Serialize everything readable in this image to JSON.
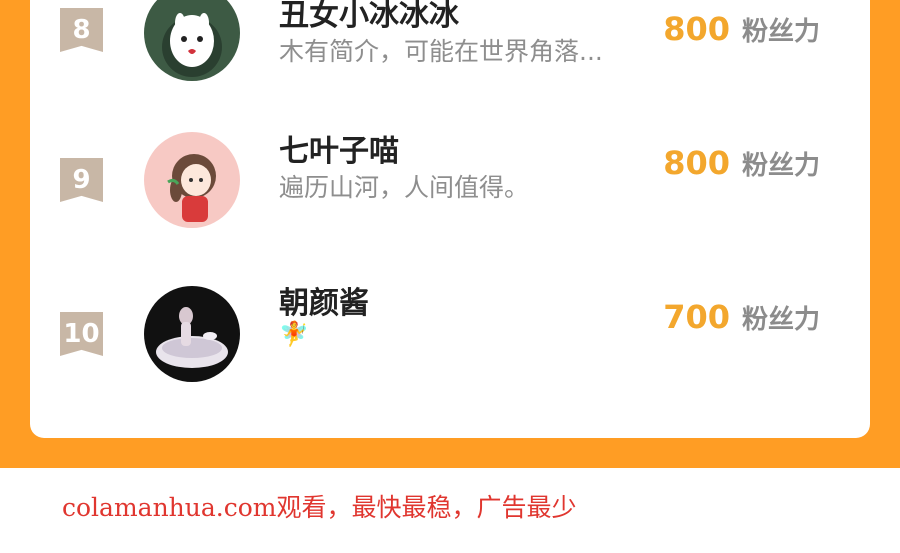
{
  "leaderboard": {
    "score_unit": "粉丝力",
    "items": [
      {
        "rank": "8",
        "name": "丑女小冰冰冰",
        "bio": "木有简介，可能在世界角落...",
        "score": "800",
        "avatar_icon": "white-cat-avatar"
      },
      {
        "rank": "9",
        "name": "七叶子喵",
        "bio": "遍历山河，人间值得。",
        "score": "800",
        "avatar_icon": "chibi-girl-avatar"
      },
      {
        "rank": "10",
        "name": "朝颜酱",
        "bio": "🧚",
        "score": "700",
        "avatar_icon": "figure-in-bowl-avatar"
      }
    ]
  },
  "footer": {
    "promo_text": "colamanhua.com观看，最快最稳，广告最少"
  },
  "colors": {
    "accent_orange": "#ff9d24",
    "score_color": "#f3a72d",
    "rank_badge": "#c8b7a6",
    "promo_red": "#e0362f"
  }
}
